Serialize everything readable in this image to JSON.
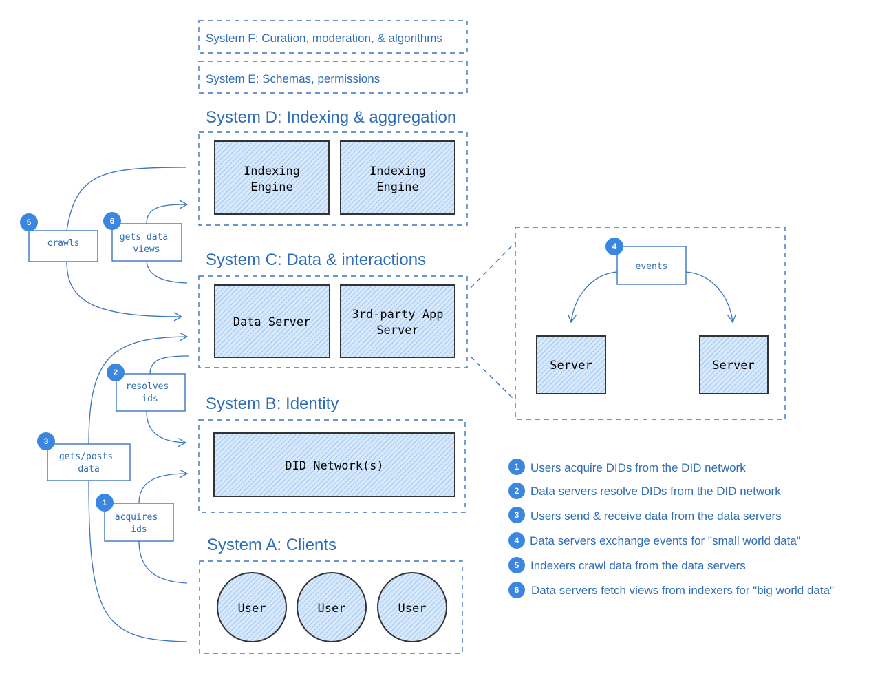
{
  "colors": {
    "accent": "#3a86e0",
    "text": "#2f6db5",
    "hatch": "#a9cdf3"
  },
  "systems": {
    "f": "System F: Curation, moderation, & algorithms",
    "e": "System E: Schemas, permissions",
    "d": "System D: Indexing & aggregation",
    "c": "System C: Data & interactions",
    "b": "System B: Identity",
    "a": "System A: Clients"
  },
  "nodes": {
    "indexing1": [
      "Indexing",
      "Engine"
    ],
    "indexing2": [
      "Indexing",
      "Engine"
    ],
    "data_server": "Data Server",
    "third_party": [
      "3rd-party App",
      "Server"
    ],
    "did": "DID Network(s)",
    "users": [
      "User",
      "User",
      "User"
    ],
    "servers": [
      "Server",
      "Server"
    ]
  },
  "edges": {
    "crawls": {
      "badge": "5",
      "lines": [
        "crawls"
      ]
    },
    "gets_views": {
      "badge": "6",
      "lines": [
        "gets data",
        "views"
      ]
    },
    "resolves": {
      "badge": "2",
      "lines": [
        "resolves",
        "ids"
      ]
    },
    "gets_posts": {
      "badge": "3",
      "lines": [
        "gets/posts",
        "data"
      ]
    },
    "acquires": {
      "badge": "1",
      "lines": [
        "acquires",
        "ids"
      ]
    },
    "events": {
      "badge": "4",
      "lines": [
        "events"
      ]
    }
  },
  "legend": [
    {
      "n": "1",
      "text": "Users acquire DIDs from the DID network"
    },
    {
      "n": "2",
      "text": "Data servers resolve DIDs from the DID network"
    },
    {
      "n": "3",
      "text": "Users send & receive data from the data servers"
    },
    {
      "n": "4",
      "text": "Data servers exchange events for \"small world data\""
    },
    {
      "n": "5",
      "text": "Indexers crawl data from the data servers"
    },
    {
      "n": "6",
      "text": "Data servers fetch views from indexers for \"big world data\""
    }
  ]
}
